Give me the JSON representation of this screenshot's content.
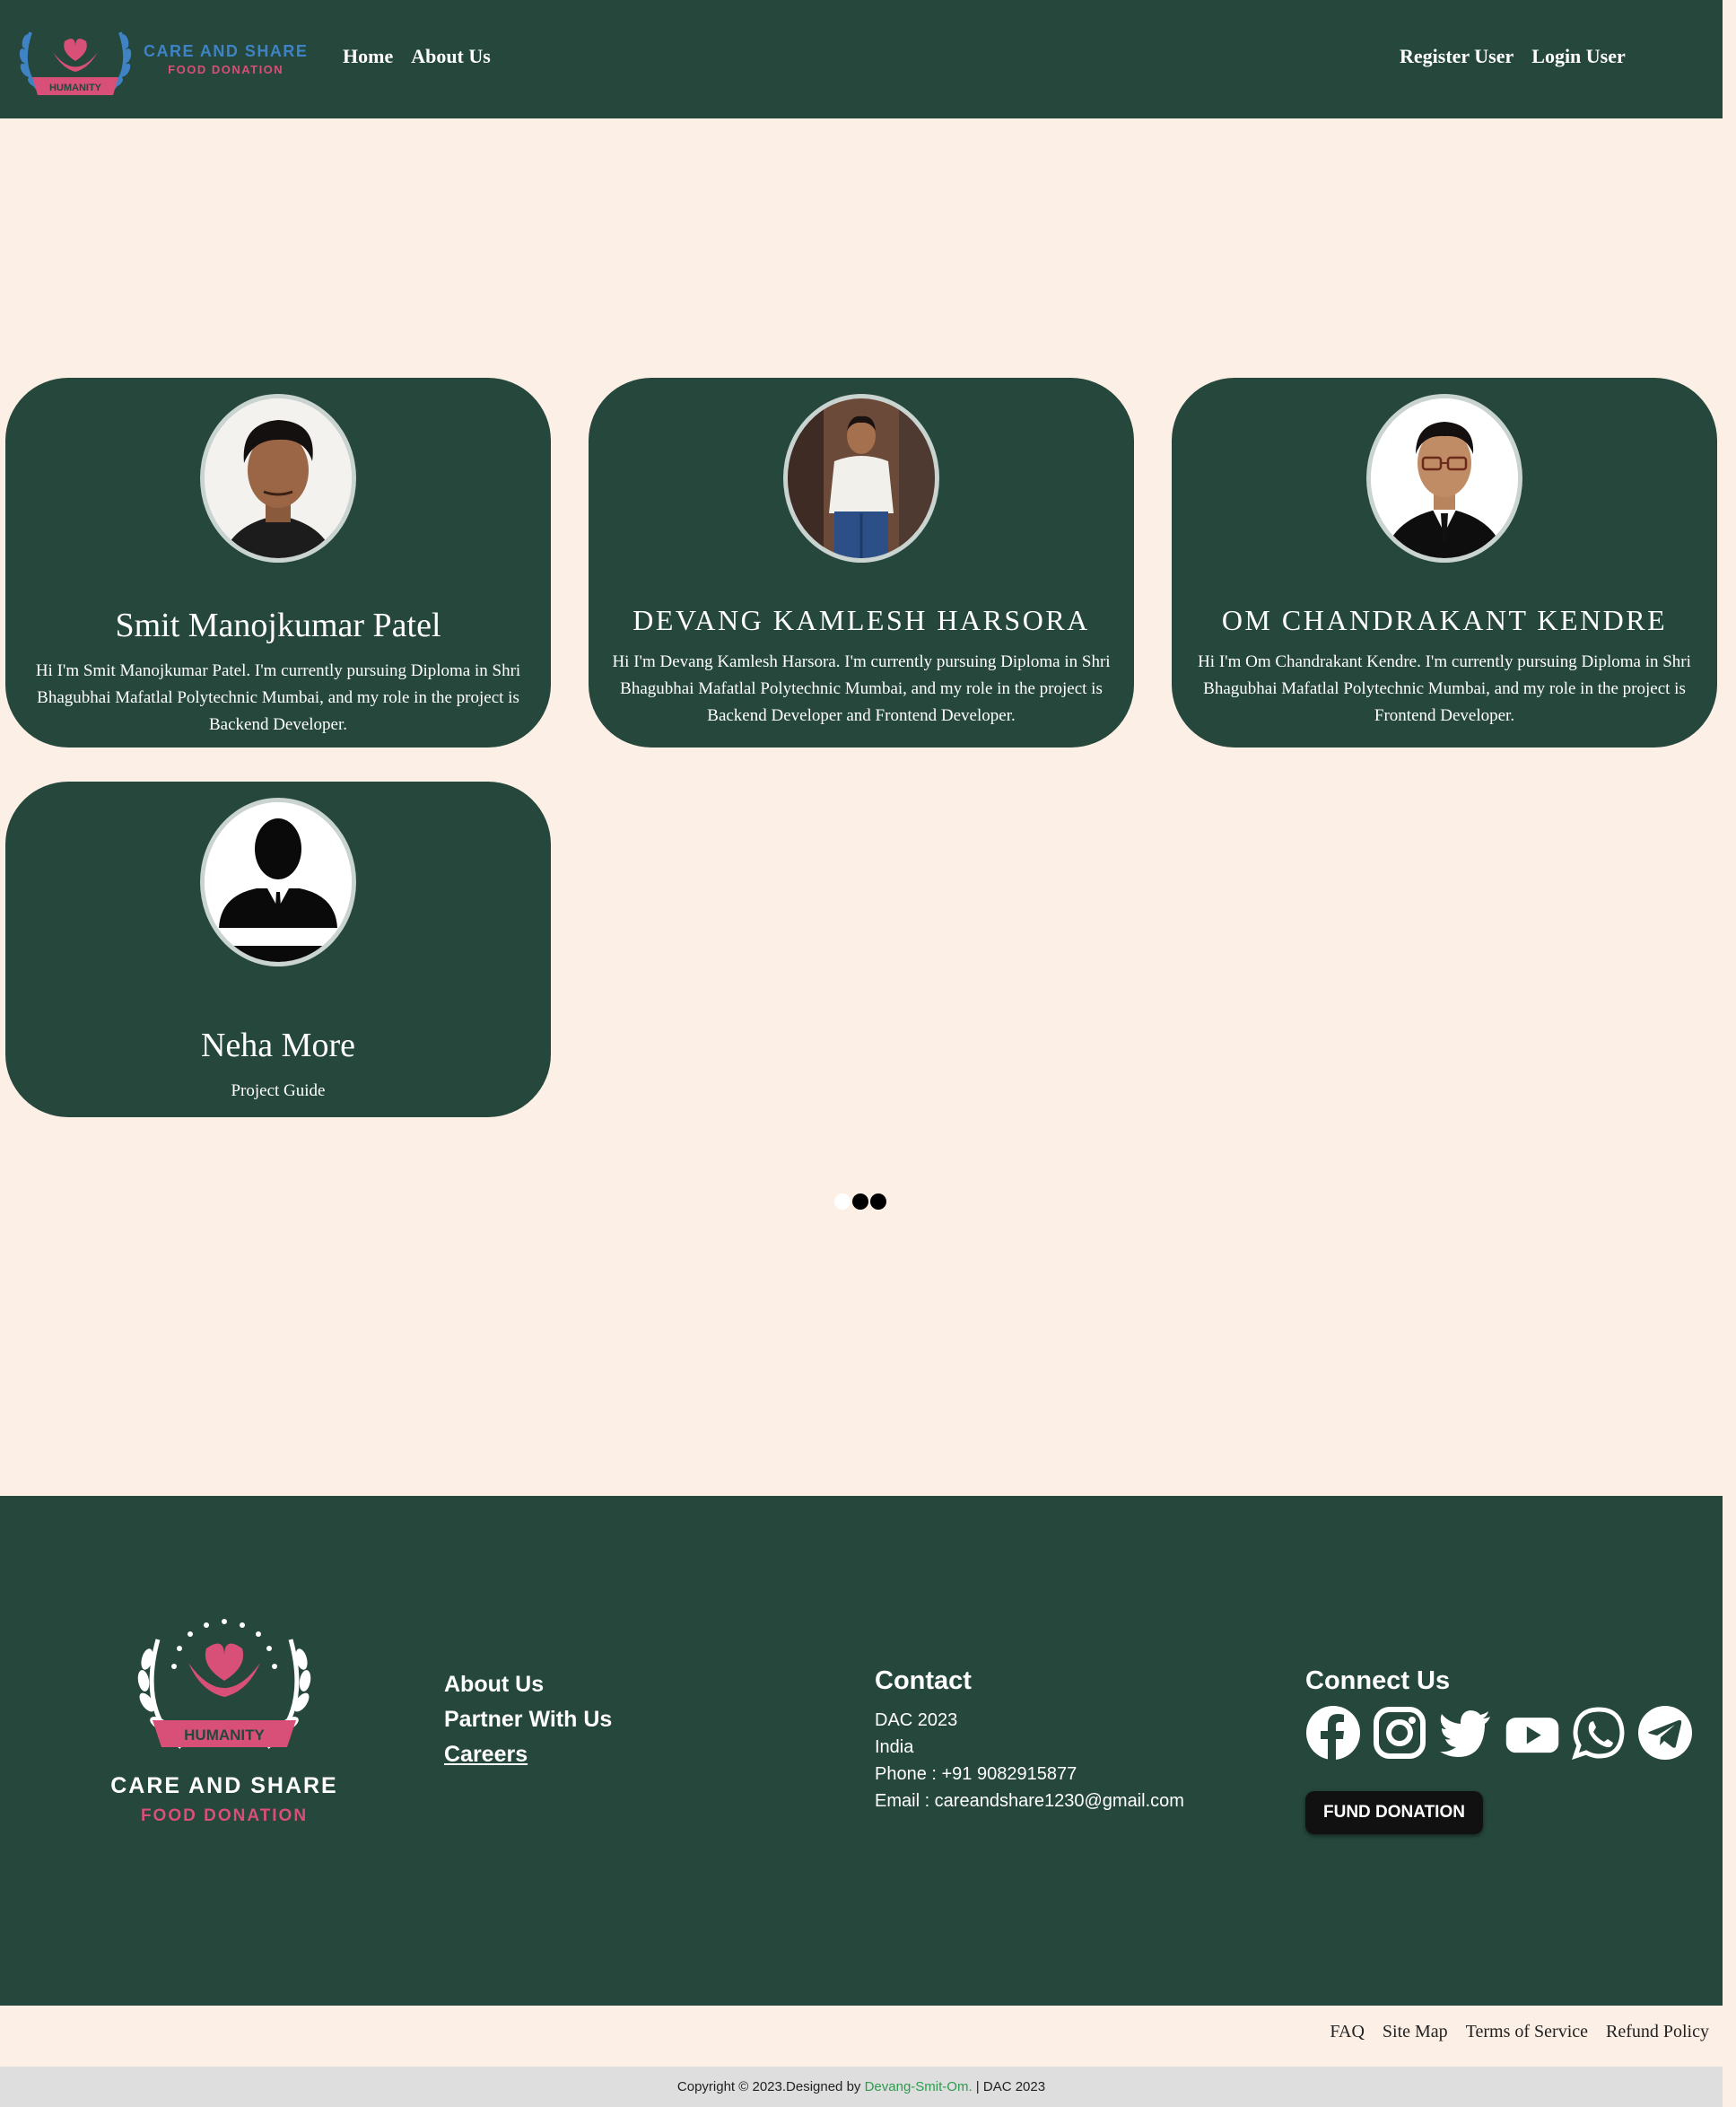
{
  "header": {
    "brand_line1": "CARE AND SHARE",
    "brand_line2": "FOOD DONATION",
    "badge": "HUMANITY",
    "nav_left": [
      "Home",
      "About Us"
    ],
    "nav_right": [
      "Register User",
      "Login User"
    ]
  },
  "team": [
    {
      "name": "Smit Manojkumar Patel",
      "bio": "Hi I'm Smit Manojkumar Patel. I'm currently pursuing Diploma in Shri Bhagubhai Mafatlal Polytechnic Mumbai, and my role in the project is Backend Developer."
    },
    {
      "name": "DEVANG KAMLESH HARSORA",
      "bio": "Hi I'm Devang Kamlesh Harsora. I'm currently pursuing Diploma in Shri Bhagubhai Mafatlal Polytechnic Mumbai, and my role in the project is Backend Developer and Frontend Developer."
    },
    {
      "name": "OM CHANDRAKANT KENDRE",
      "bio": "Hi I'm Om Chandrakant Kendre. I'm currently pursuing Diploma in Shri Bhagubhai Mafatlal Polytechnic Mumbai, and my role in the project is Frontend Developer."
    },
    {
      "name": "Neha More",
      "bio": "Project Guide"
    }
  ],
  "footer": {
    "brand_line1": "CARE AND SHARE",
    "brand_line2": "FOOD DONATION",
    "badge": "HUMANITY",
    "links": [
      "About Us",
      "Partner With Us",
      "Careers"
    ],
    "contact_title": "Contact",
    "contact_lines": [
      "DAC 2023",
      "India",
      "Phone : +91 9082915877",
      "Email : careandshare1230@gmail.com"
    ],
    "connect_title": "Connect Us",
    "social_icons": [
      "facebook-icon",
      "instagram-icon",
      "twitter-icon",
      "youtube-icon",
      "whatsapp-icon",
      "telegram-icon"
    ],
    "fund_button": "FUND DONATION"
  },
  "bottom_links": [
    "FAQ",
    "Site Map",
    "Terms of Service",
    "Refund Policy"
  ],
  "copyright": {
    "prefix": "Copyright © 2023.Designed by ",
    "designer": "Devang-Smit-Om.",
    "suffix": " | DAC 2023"
  },
  "colors": {
    "primary_green": "#25473c",
    "background": "#fcefe6",
    "accent_pink": "#d84f78",
    "accent_blue": "#3f83c5"
  }
}
